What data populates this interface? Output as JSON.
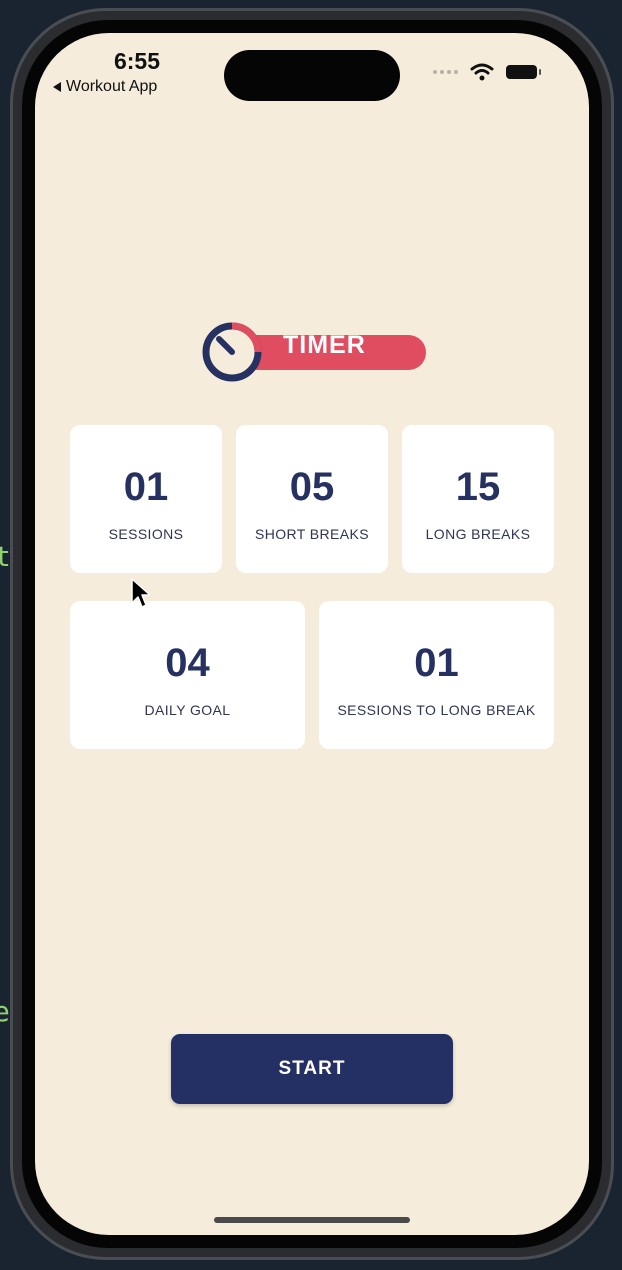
{
  "status_bar": {
    "time": "6:55",
    "back_app": "Workout App"
  },
  "logo": {
    "text": "TIMER",
    "accent_color": "#e04d61",
    "icon": "timer-icon"
  },
  "stats": [
    {
      "value": "01",
      "label": "SESSIONS"
    },
    {
      "value": "05",
      "label": "SHORT BREAKS"
    },
    {
      "value": "15",
      "label": "LONG BREAKS"
    },
    {
      "value": "04",
      "label": "DAILY GOAL"
    },
    {
      "value": "01",
      "label": "SESSIONS TO LONG BREAK"
    }
  ],
  "start_button": {
    "label": "START",
    "color": "#243064"
  },
  "theme": {
    "background": "#f5ecdb",
    "card": "#ffffff",
    "value_color": "#263161"
  }
}
